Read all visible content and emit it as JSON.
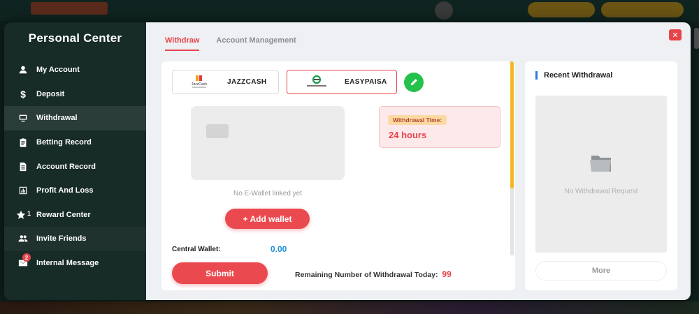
{
  "sidebar": {
    "title": "Personal Center",
    "items": [
      {
        "label": "My Account",
        "icon": "user-icon"
      },
      {
        "label": "Deposit",
        "icon": "dollar-icon"
      },
      {
        "label": "Withdrawal",
        "icon": "monitor-icon"
      },
      {
        "label": "Betting Record",
        "icon": "clipboard-icon"
      },
      {
        "label": "Account Record",
        "icon": "document-icon"
      },
      {
        "label": "Profit And Loss",
        "icon": "chart-icon"
      },
      {
        "label": "Reward Center",
        "icon": "star-icon",
        "count": "1"
      },
      {
        "label": "Invite Friends",
        "icon": "people-icon"
      },
      {
        "label": "Internal Message",
        "icon": "mail-icon",
        "badge": "2"
      }
    ],
    "active_index": 2
  },
  "tabs": [
    {
      "label": "Withdraw",
      "active": true
    },
    {
      "label": "Account Management",
      "active": false
    }
  ],
  "close_label": "✕",
  "wallets": [
    {
      "name": "JAZZCASH",
      "logo_text": "JazzCash",
      "selected": false
    },
    {
      "name": "EASYPAISA",
      "selected": true
    }
  ],
  "no_wallet_text": "No E-Wallet linked yet",
  "add_wallet_label": "+ Add wallet",
  "withdrawal_time": {
    "label": "Withdrawal Time:",
    "value": "24 hours"
  },
  "central_wallet": {
    "label": "Central Wallet:",
    "value": "0.00"
  },
  "submit_label": "Submit",
  "remaining": {
    "label": "Remaining Number of Withdrawal Today:",
    "value": "99"
  },
  "recent": {
    "title": "Recent Withdrawal",
    "empty_text": "No Withdrawal Request",
    "more_label": "More"
  },
  "colors": {
    "accent": "#e8434a",
    "sidebar_bg": "#172b27",
    "value_blue": "#1e8fd7",
    "edit_green": "#24c24a",
    "scroll_thumb": "#f2b829"
  }
}
